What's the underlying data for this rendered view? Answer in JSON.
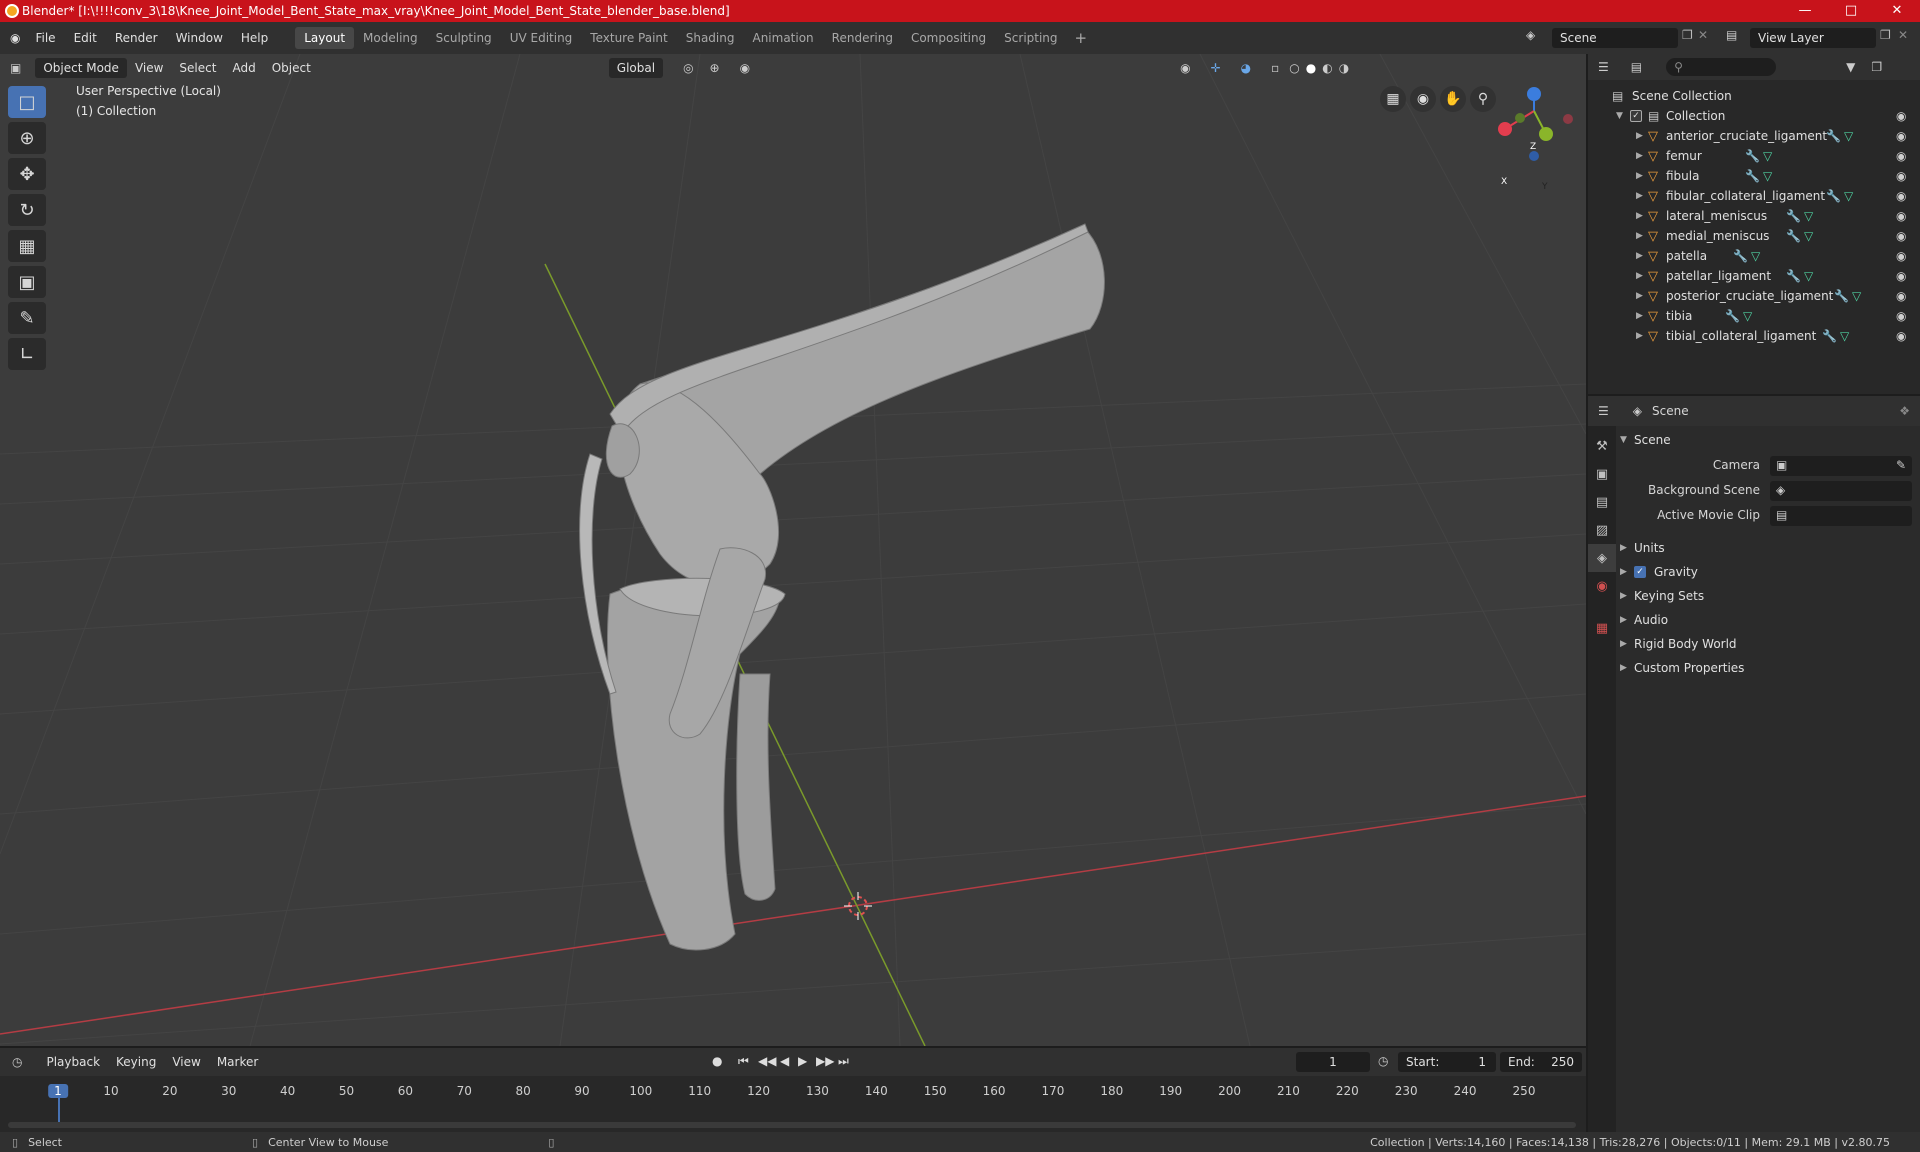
{
  "titlebar": {
    "title": "Blender* [I:\\!!!!conv_3\\18\\Knee_Joint_Model_Bent_State_max_vray\\Knee_Joint_Model_Bent_State_blender_base.blend]"
  },
  "menus": [
    "File",
    "Edit",
    "Render",
    "Window",
    "Help"
  ],
  "workspaces": [
    {
      "label": "Layout",
      "active": true
    },
    {
      "label": "Modeling"
    },
    {
      "label": "Sculpting"
    },
    {
      "label": "UV Editing"
    },
    {
      "label": "Texture Paint"
    },
    {
      "label": "Shading"
    },
    {
      "label": "Animation"
    },
    {
      "label": "Rendering"
    },
    {
      "label": "Compositing"
    },
    {
      "label": "Scripting"
    }
  ],
  "scene_selector": "Scene",
  "view_layer": "View Layer",
  "viewport": {
    "mode": "Object Mode",
    "menus": [
      "View",
      "Select",
      "Add",
      "Object"
    ],
    "orientation": "Global",
    "perspective_label": "User Perspective (Local)",
    "collection_label": "(1) Collection",
    "gizmo_axes": {
      "x": "X",
      "y": "Y",
      "z": "Z"
    },
    "colors": {
      "x_axis": "#b43c44",
      "y_axis": "#7a9a2b",
      "bg": "#3c3c3c"
    }
  },
  "outliner": {
    "root": "Scene Collection",
    "collection": "Collection",
    "objects": [
      "anterior_cruciate_ligament",
      "femur",
      "fibula",
      "fibular_collateral_ligament",
      "lateral_meniscus",
      "medial_meniscus",
      "patella",
      "patellar_ligament",
      "posterior_cruciate_ligament",
      "tibia",
      "tibial_collateral_ligament"
    ]
  },
  "properties": {
    "header": "Scene",
    "section_open": "Scene",
    "fields": {
      "camera": "Camera",
      "background_scene": "Background Scene",
      "active_movie_clip": "Active Movie Clip"
    },
    "sections": [
      "Units",
      "Gravity",
      "Keying Sets",
      "Audio",
      "Rigid Body World",
      "Custom Properties"
    ]
  },
  "timeline": {
    "menus": [
      "Playback",
      "Keying",
      "View",
      "Marker"
    ],
    "current_frame": "1",
    "start_label": "Start:",
    "start": "1",
    "end_label": "End:",
    "end": "250",
    "ruler": [
      "1",
      "10",
      "20",
      "30",
      "40",
      "50",
      "60",
      "70",
      "80",
      "90",
      "100",
      "110",
      "120",
      "130",
      "140",
      "150",
      "160",
      "170",
      "180",
      "190",
      "200",
      "210",
      "220",
      "230",
      "240",
      "250"
    ]
  },
  "statusbar": {
    "left": "Select",
    "middle": "Center View to Mouse",
    "right": "Collection | Verts:14,160 | Faces:14,138 | Tris:28,276 | Objects:0/11 | Mem: 29.1 MB | v2.80.75"
  }
}
